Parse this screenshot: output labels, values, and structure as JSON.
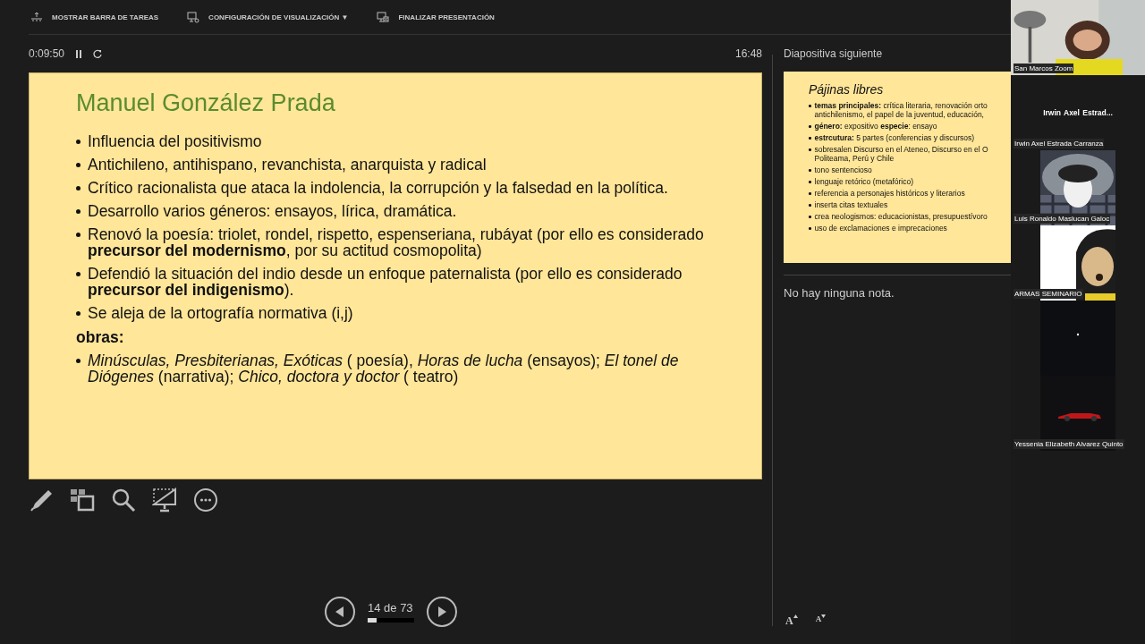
{
  "toolbar": [
    {
      "label": "MOSTRAR BARRA DE TAREAS",
      "kind": "taskbar"
    },
    {
      "label": "CONFIGURACIÓN DE VISUALIZACIÓN ▼",
      "kind": "display"
    },
    {
      "label": "FINALIZAR PRESENTACIÓN",
      "kind": "end"
    }
  ],
  "timer": {
    "elapsed": "0:09:50",
    "clock": "16:48"
  },
  "slide": {
    "title": "Manuel González Prada",
    "bullets": [
      "Influencia del positivismo",
      "Antichileno, antihispano, revanchista, anarquista y radical",
      "Crítico racionalista que ataca la indolencia, la corrupción y la falsedad en la política.",
      "Desarrollo varios géneros: ensayos, lírica, dramática.",
      "Renovó la poesía: triolet, rondel, rispetto, espenseriana, rubáyat (por ello es considerado **precursor del modernismo**, por su actitud cosmopolita)",
      "Defendió la situación del indio desde un enfoque paternalista (por ello es considerado **precursor del indigenismo**).",
      "Se aleja de la ortografía normativa (i,j)"
    ],
    "works_heading": "obras:",
    "works": [
      "*Minúsculas, Presbiterianas, Exóticas* ( poesía),  *Horas de lucha* (ensayos); *El tonel de Diógenes* (narrativa); *Chico, doctora y doctor* ( teatro)"
    ]
  },
  "slide_tools": [
    {
      "kind": "pen"
    },
    {
      "kind": "slides"
    },
    {
      "kind": "zoom"
    },
    {
      "kind": "screen"
    },
    {
      "kind": "more"
    }
  ],
  "navigation": {
    "counter": "14 de 73",
    "level": 0.19
  },
  "next_slide": {
    "heading": "Diapositiva siguiente",
    "title": "Pájinas libres",
    "bullets": [
      [
        "**temas principales:** crítica literaria, renovación orto",
        "antichilenismo, el papel de la juventud, educación,"
      ],
      [
        "**género:** expositivo   **especie**: ensayo"
      ],
      [
        "**estrcutura:** 5 partes (conferencias y discursos)"
      ],
      [
        "sobresalen Discurso en el Ateneo, Discurso en el O",
        "Politeama, Perú y Chile"
      ],
      [
        "tono sentencioso"
      ],
      [
        "lenguaje retórico (metafórico)"
      ],
      [
        "referencia a personajes históricos y literarios"
      ],
      [
        "inserta citas textuales"
      ],
      [
        "crea neologismos: educacionistas, presupuestívoro"
      ],
      [
        "uso de exclamaciones e imprecaciones"
      ]
    ]
  },
  "notes": {
    "text": "No hay ninguna nota."
  },
  "font_buttons": [
    {
      "label": "A",
      "kind": "increase"
    },
    {
      "label": "A",
      "kind": "decrease"
    }
  ],
  "participants": [
    {
      "kind": "picture",
      "name": "San Marcos Zoom"
    },
    {
      "kind": "name",
      "display": "Irwin  Axel  Estrad...",
      "name": "Irwin Axel Estrada Carranza"
    },
    {
      "kind": "picture",
      "name": "Luis Ronaldo Maslucan Galoc"
    },
    {
      "kind": "picture",
      "name": "ARMAS SEMINARIO"
    },
    {
      "kind": "picture"
    },
    {
      "kind": "picture",
      "name": "Yessenia Elizabeth Alvarez Quinto"
    }
  ]
}
